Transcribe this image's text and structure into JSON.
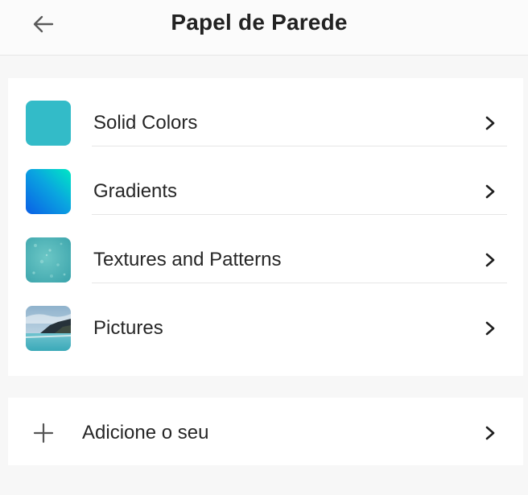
{
  "header": {
    "title": "Papel de Parede",
    "back_icon": "back-arrow-icon"
  },
  "wallpaper_categories": [
    {
      "label": "Solid Colors",
      "thumb": "solid-colors-thumbnail",
      "color": "#33bbc8"
    },
    {
      "label": "Gradients",
      "thumb": "gradients-thumbnail",
      "colors": [
        "#0a6fe0",
        "#00e0c8"
      ]
    },
    {
      "label": "Textures and Patterns",
      "thumb": "textures-thumbnail",
      "color": "#4fb4b8"
    },
    {
      "label": "Pictures",
      "thumb": "pictures-thumbnail"
    }
  ],
  "add": {
    "label": "Adicione o seu",
    "icon": "plus-icon"
  },
  "chevron_icon": "chevron-right-icon",
  "colors": {
    "background": "#f7f7f7",
    "card": "#ffffff",
    "divider": "#e6e6e6",
    "text": "#262626"
  }
}
